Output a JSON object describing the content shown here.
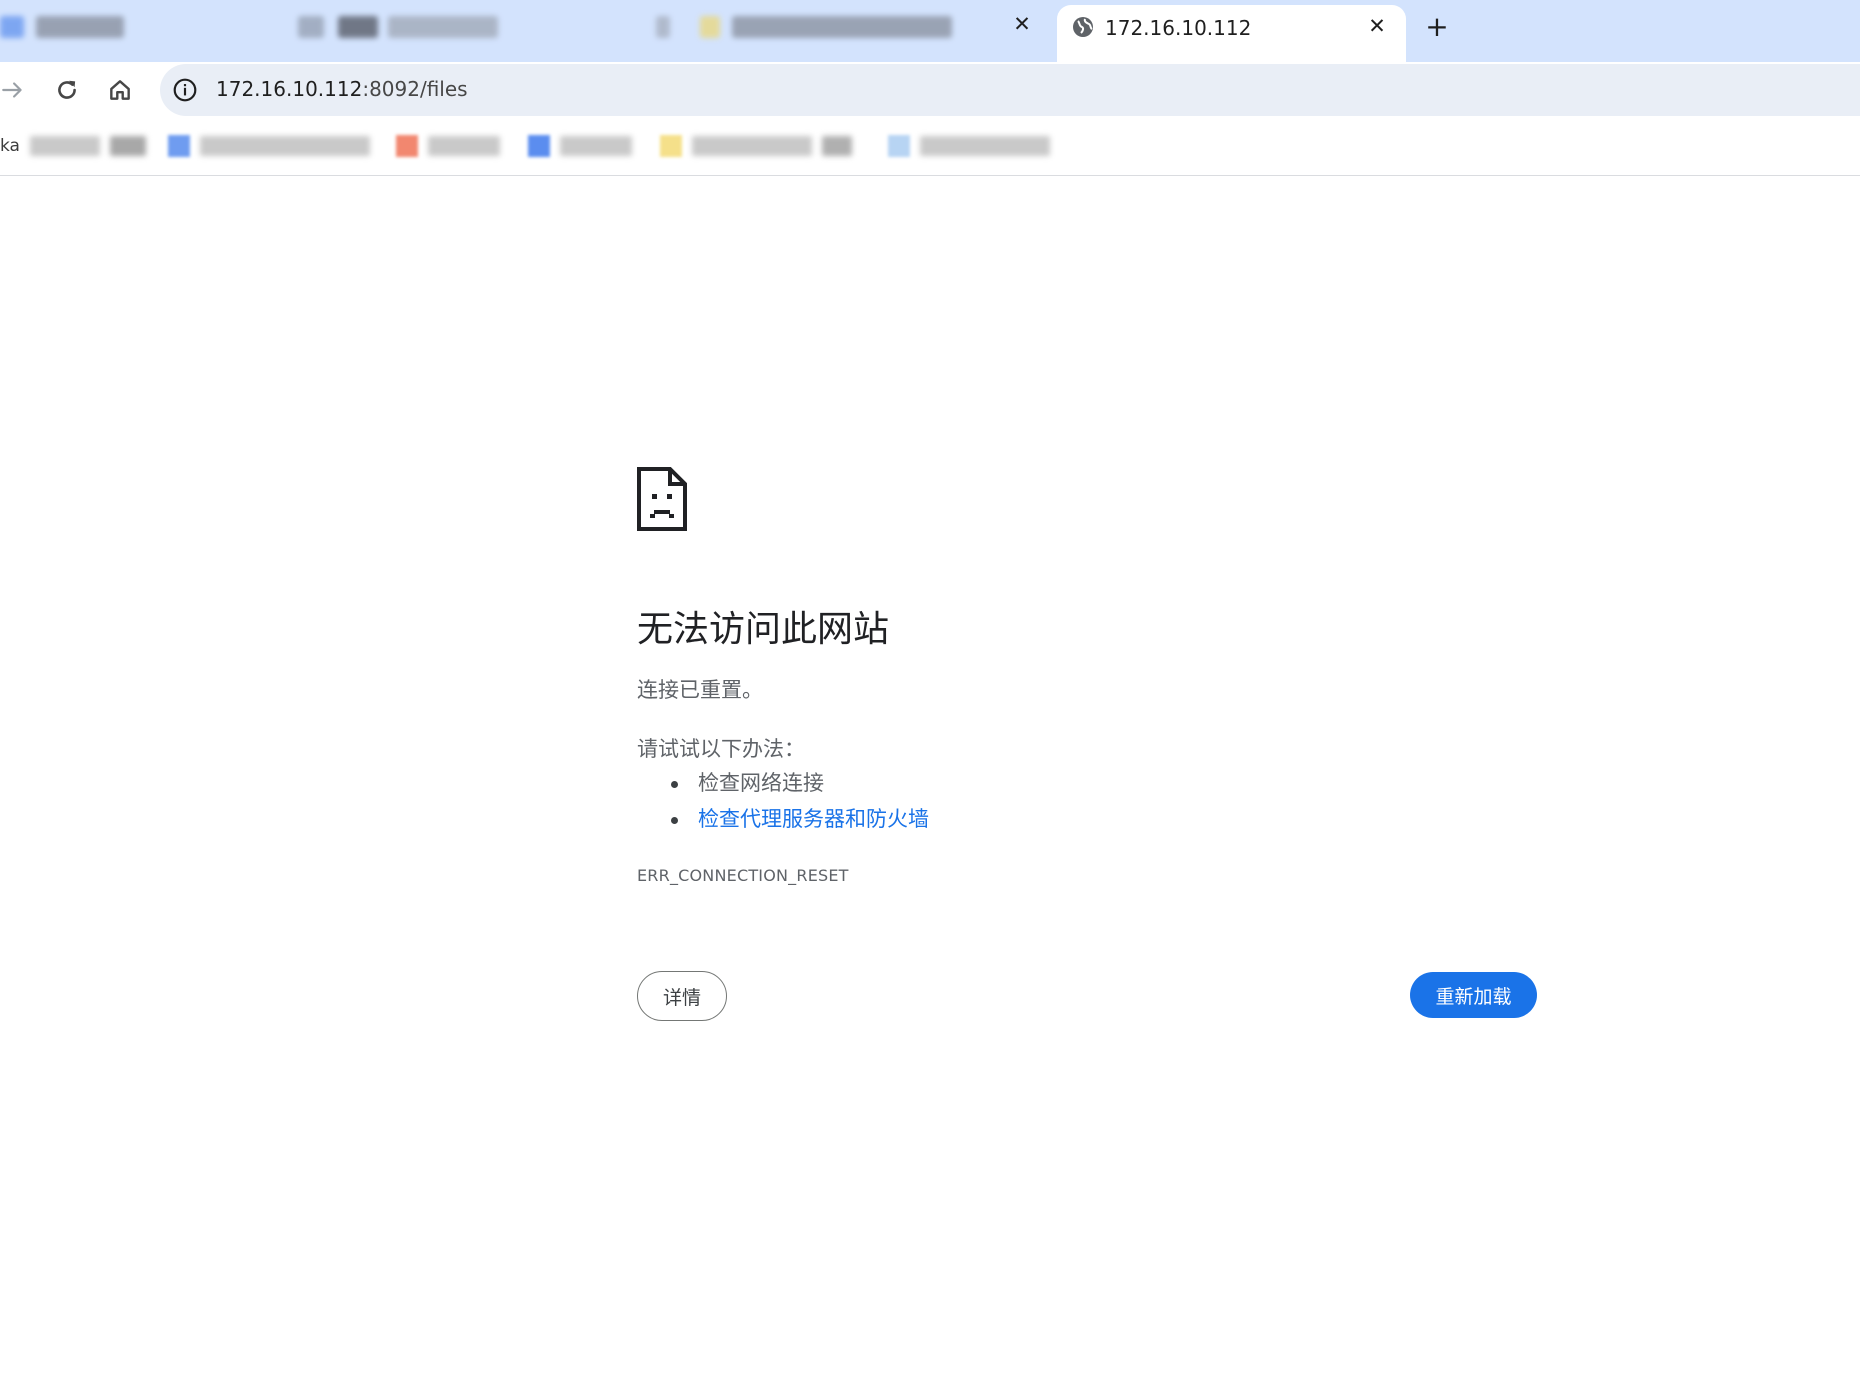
{
  "browser": {
    "tabs": [
      {
        "label": "",
        "active": false
      },
      {
        "label": "",
        "active": false
      },
      {
        "label": "",
        "active": false
      },
      {
        "label": "172.16.10.112",
        "active": true
      }
    ],
    "new_tab_symbol": "+",
    "close_symbol": "✕",
    "omnibox": {
      "host": "172.16.10.112",
      "path": ":8092/files"
    },
    "bookmarks": [
      {
        "label": "ka"
      },
      {
        "label": ""
      },
      {
        "label": ""
      },
      {
        "label": ""
      },
      {
        "label": ""
      },
      {
        "label": ""
      }
    ]
  },
  "icons": {
    "back": "arrow-left-icon",
    "forward": "arrow-right-icon",
    "reload": "reload-icon",
    "home": "home-icon",
    "site_info": "info-icon",
    "tab_favicon": "globe-icon",
    "error_page": "sad-document-icon"
  },
  "error_page": {
    "title": "无法访问此网站",
    "subtitle": "连接已重置。",
    "try_heading": "请试试以下办法：",
    "suggestions": [
      {
        "text": "检查网络连接",
        "link": false
      },
      {
        "text": "检查代理服务器和防火墙",
        "link": true
      }
    ],
    "error_code": "ERR_CONNECTION_RESET",
    "details_button": "详情",
    "reload_button": "重新加载"
  },
  "colors": {
    "tab_strip_bg": "#d3e3fd",
    "omnibox_bg": "#e9eef6",
    "primary_button": "#1a73e8",
    "link": "#1a73e8",
    "body_text": "#5f6368"
  }
}
